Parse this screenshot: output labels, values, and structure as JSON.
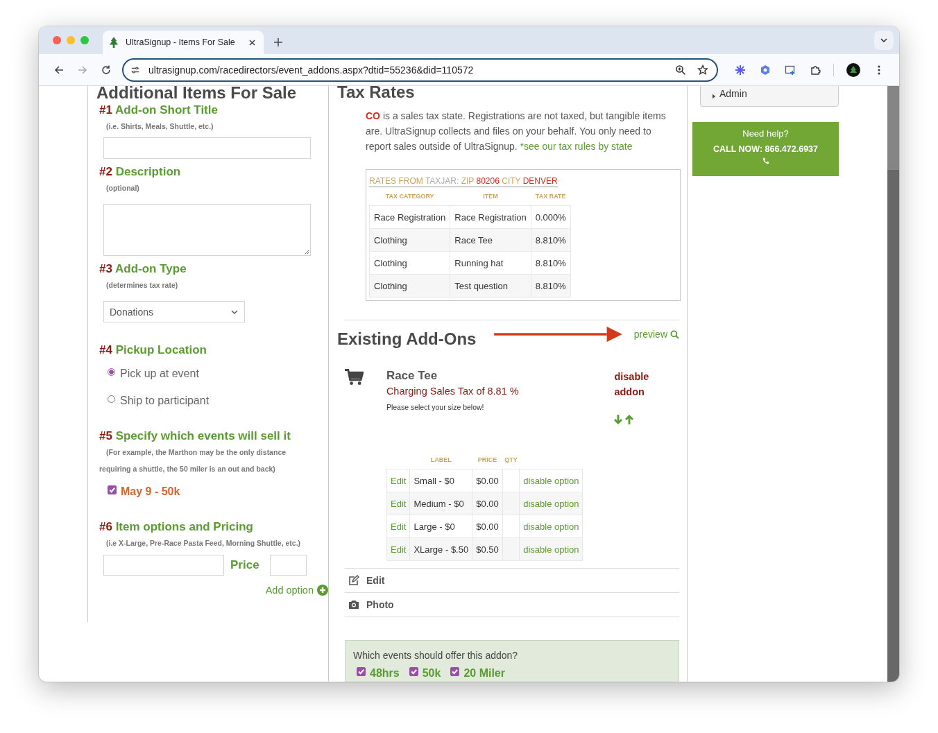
{
  "browser": {
    "tab_title": "UltraSignup - Items For Sale",
    "url": "ultrasignup.com/racedirectors/event_addons.aspx?dtid=55236&did=110572"
  },
  "form": {
    "title": "Additional Items For Sale",
    "steps": [
      {
        "number": "#1",
        "title": "Add-on Short Title",
        "hint": "(i.e. Shirts, Meals, Shuttle, etc.)",
        "kind": "text"
      },
      {
        "number": "#2",
        "title": "Description",
        "hint": "(optional)",
        "kind": "textarea"
      },
      {
        "number": "#3",
        "title": "Add-on Type",
        "hint": "(determines tax rate)",
        "kind": "select",
        "value": "Donations"
      },
      {
        "number": "#4",
        "title": "Pickup Location",
        "kind": "radio",
        "options": [
          {
            "label": "Pick up at event",
            "selected": true
          },
          {
            "label": "Ship to participant",
            "selected": false
          }
        ]
      },
      {
        "number": "#5",
        "title": "Specify which events will sell it",
        "hint": "(For example, the Marthon may be the only distance requiring a shuttle, the 50 miler is an out and back)",
        "kind": "checkbox",
        "options": [
          {
            "label": "May 9 - 50k",
            "checked": true
          }
        ]
      },
      {
        "number": "#6",
        "title": "Item options and Pricing",
        "hint": "(i.e X-Large, Pre-Race Pasta Feed, Morning Shuttle, etc.)",
        "kind": "pricing",
        "price_label": "Price",
        "add_label": "Add option"
      }
    ]
  },
  "tax": {
    "title": "Tax Rates",
    "state": "CO",
    "intro": "is a sales tax state. Registrations are not taxed, but tangible items are. UltraSignup collects and files on your behalf. You only need to report sales outside of UltraSignup.",
    "link": "*see our tax rules by state",
    "source": {
      "prefix": "RATES FROM",
      "provider": "TAXJAR:",
      "zip_label": "ZIP",
      "zip": "80206",
      "city_label": "CITY",
      "city": "DENVER"
    },
    "columns": [
      "TAX CATEGORY",
      "ITEM",
      "TAX RATE"
    ],
    "rows": [
      {
        "category": "Race Registration",
        "item": "Race Registration",
        "rate": "0.000%"
      },
      {
        "category": "Clothing",
        "item": "Race Tee",
        "rate": "8.810%"
      },
      {
        "category": "Clothing",
        "item": "Running hat",
        "rate": "8.810%"
      },
      {
        "category": "Clothing",
        "item": "Test question",
        "rate": "8.810%"
      }
    ]
  },
  "addons": {
    "title": "Existing Add-Ons",
    "preview": "preview",
    "item": {
      "name": "Race Tee",
      "tax_note": "Charging Sales Tax of 8.81 %",
      "description": "Please select your size below!",
      "disable": "disable addon",
      "columns": [
        "LABEL",
        "PRICE",
        "QTY"
      ],
      "options": [
        {
          "edit": "Edit",
          "label": "Small - $0",
          "price": "$0.00",
          "action": "disable option"
        },
        {
          "edit": "Edit",
          "label": "Medium - $0",
          "price": "$0.00",
          "action": "disable option"
        },
        {
          "edit": "Edit",
          "label": "Large - $0",
          "price": "$0.00",
          "action": "disable option"
        },
        {
          "edit": "Edit",
          "label": "XLarge - $.50",
          "price": "$0.50",
          "action": "disable option"
        }
      ],
      "actions": [
        {
          "kind": "edit",
          "label": "Edit"
        },
        {
          "kind": "photo",
          "label": "Photo"
        }
      ],
      "events_question": "Which events should offer this addon?",
      "events": [
        {
          "label": "48hrs",
          "checked": true
        },
        {
          "label": "50k",
          "checked": true
        },
        {
          "label": "20 Miler",
          "checked": true
        }
      ]
    }
  },
  "sidebar": {
    "admin": {
      "label": "Admin",
      "expanded": false
    },
    "help": {
      "title": "Need help?",
      "phone": "CALL NOW: 866.472.6937"
    }
  }
}
